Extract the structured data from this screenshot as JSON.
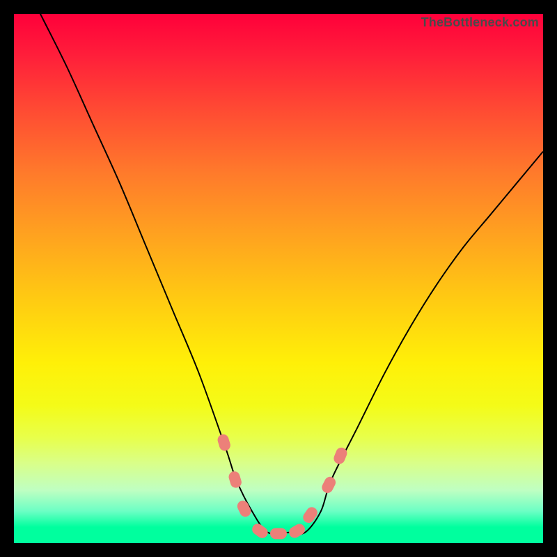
{
  "watermark": "TheBottleneck.com",
  "colors": {
    "frame": "#000000",
    "gradient_top": "#ff003a",
    "gradient_bottom": "#00ff9e",
    "curve": "#000000",
    "marker": "#ec8079"
  },
  "chart_data": {
    "type": "line",
    "title": "",
    "xlabel": "",
    "ylabel": "",
    "xlim": [
      0,
      100
    ],
    "ylim": [
      0,
      100
    ],
    "note": "Axes have no visible tick labels; x is normalized position across the plot, y is normalized bottleneck percentage (0 at bottom, 100 at top).",
    "series": [
      {
        "name": "bottleneck-curve",
        "x": [
          0,
          5,
          10,
          15,
          20,
          25,
          30,
          35,
          40,
          42,
          45,
          48,
          52,
          55,
          58,
          60,
          65,
          70,
          75,
          80,
          85,
          90,
          95,
          100
        ],
        "y": [
          110,
          100,
          90,
          79,
          68,
          56,
          44,
          32,
          18,
          12,
          6,
          2,
          2,
          2,
          6,
          12,
          22,
          32,
          41,
          49,
          56,
          62,
          68,
          74
        ]
      }
    ],
    "markers": {
      "name": "highlight-capsules",
      "points": [
        {
          "x": 39.7,
          "y": 19
        },
        {
          "x": 41.8,
          "y": 12
        },
        {
          "x": 43.5,
          "y": 6.5
        },
        {
          "x": 46.5,
          "y": 2.3
        },
        {
          "x": 50.0,
          "y": 1.8
        },
        {
          "x": 53.5,
          "y": 2.3
        },
        {
          "x": 56.0,
          "y": 5.3
        },
        {
          "x": 59.5,
          "y": 11
        },
        {
          "x": 61.7,
          "y": 16.5
        }
      ]
    }
  }
}
